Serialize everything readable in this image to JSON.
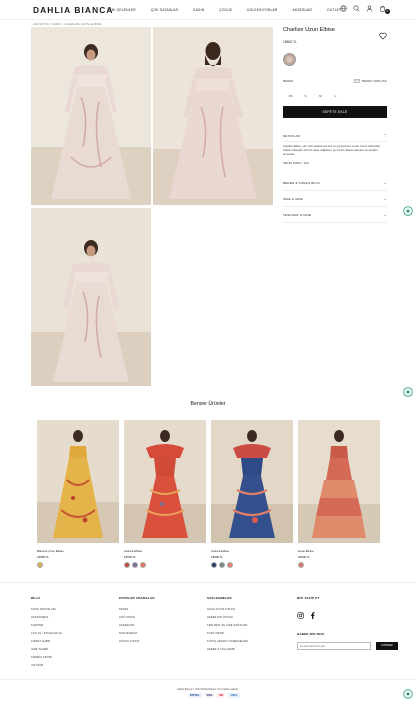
{
  "header": {
    "logo": "DAHLIA BIANCA",
    "nav": [
      "YENİ GELENLER",
      "ÇOK SATANLAR",
      "KADIN",
      "ÇOCUK",
      "KOLEKSİYONLAR",
      "AKSESUAR",
      "OUTLET"
    ],
    "cart_count": "0"
  },
  "breadcrumb": "ANASAYFA / KADIN / CHARLIZE UZUN ELBISE",
  "product": {
    "title": "Charlize Uzun Elbise",
    "price": "18500 TL",
    "size_label": "BEDEN",
    "size_chart": "BEDEN TABLOSU",
    "sizes": [
      "XS",
      "S",
      "M",
      "L"
    ],
    "add_to_cart": "SEPETE EKLE",
    "details_label": "DETAYLAR",
    "details_text": "Charlize Elbise, yaz ruhlu tasarımıyla kırlı ve şık görünüm sunar. Omuz hattındaki balonlu detayları zarif bir siluet sağlarken, şık tonları dikkat çekerken ve şıklığını tamamlar.",
    "ecode": "ÜRÜN KODU: 104",
    "accordions": [
      "BEDEN & KUMAŞ BİLGİ",
      "İADE & İADE",
      "TESLİMAT & İADE"
    ]
  },
  "similar": {
    "title": "Benzer Ürünler",
    "items": [
      {
        "name": "Blanche Uzun Elbise",
        "price": "22800 TL",
        "swatches": [
          "#d8b24a"
        ]
      },
      {
        "name": "Andrea Elbise",
        "price": "18500 TL",
        "swatches": [
          "#c0504d",
          "#7a6f9b",
          "#e07a5f"
        ]
      },
      {
        "name": "Andrea Elbise",
        "price": "18500 TL",
        "swatches": [
          "#2c3e70",
          "#7a8a8a",
          "#e0806a"
        ]
      },
      {
        "name": "Hope Elbise",
        "price": "26500 TL",
        "swatches": [
          "#d47c6c"
        ]
      }
    ]
  },
  "footer": {
    "col1_title": "BİLGİ",
    "col1": [
      "SATIŞ NOKTALARI",
      "HAKKIMIZDA",
      "KARİYER",
      "LOG DL / ETİKALAR AÇ",
      "ŞİRKET HABR",
      "İADE TALEBİ",
      "SİPARİŞ TAKİBİ",
      "İLETİŞİM"
    ],
    "col2_title": "POPÜLER ARAMALAR",
    "col2": [
      "KETEN",
      "ÇOK SATAN",
      "AKSESUAR",
      "SOSYEDAVAY",
      "ÇOCUK KIYFAT"
    ],
    "col3_title": "SÖZLEŞMELER",
    "col3": [
      "GİZLİLİK POLİTİKASI",
      "ÇEREZ POLİTİKASI",
      "TESLİMAT VE İADE ŞARTLARI",
      "KVKK METNİ",
      "KUTKA ARAMA YÖNERGELERİ",
      "ÇEREZ & KULLANIMI"
    ],
    "col4_title": "BİZİ TAKİP ET",
    "newsletter_title": "HABER BÜLTENİ",
    "newsletter_placeholder": "E-posta adresinizi girin",
    "newsletter_button": "GÖNDER",
    "copyright": "Dahlia Bianca © 2024 Dahlia Bianca. Tüm hakları saklıdır.",
    "payments": [
      "PAYPAL",
      "VISA",
      "MC",
      "AMEX"
    ]
  }
}
